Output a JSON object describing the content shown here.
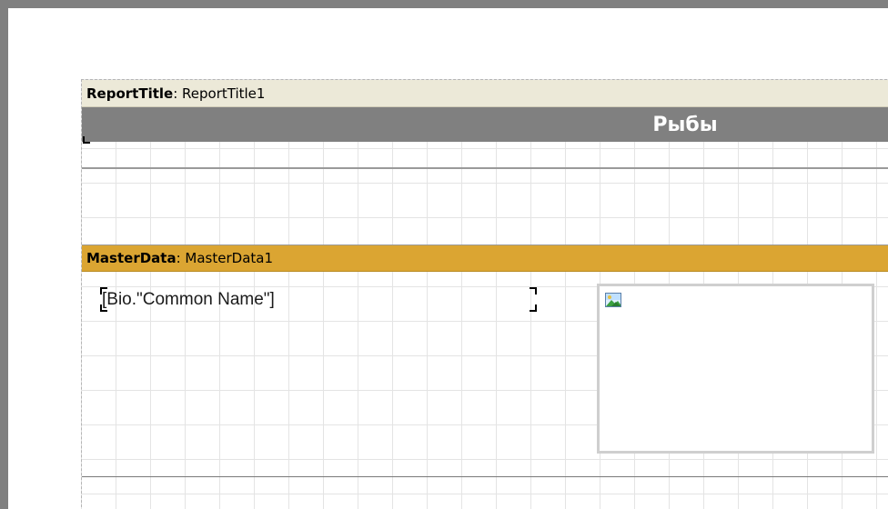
{
  "report_title_band": {
    "type_label": "ReportTitle",
    "name_label": ": ReportTitle1",
    "title_text": "Рыбы"
  },
  "master_data_band": {
    "type_label": "MasterData",
    "name_label": ": MasterData1",
    "field_text": "[Bio.\"Common Name\"]",
    "picture_icon": "image-icon"
  },
  "colors": {
    "report_title_header": "#ece9d8",
    "title_bar": "#808080",
    "master_data_header": "#dba532"
  }
}
